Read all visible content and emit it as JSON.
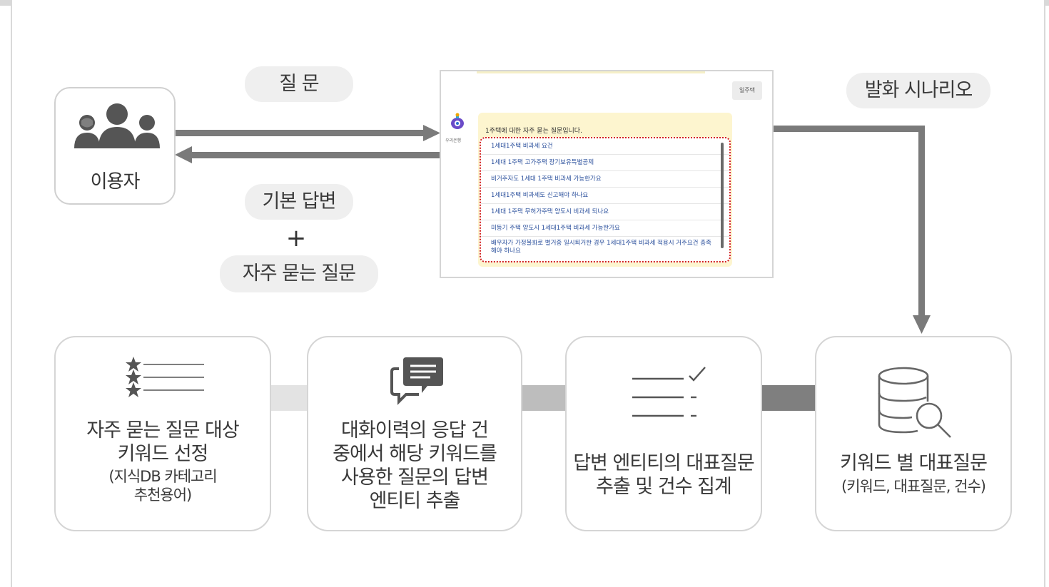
{
  "labels": {
    "question": "질 문",
    "basic_answer": "기본 답변",
    "plus": "+",
    "faq": "자주 묻는 질문",
    "scenario": "발화 시나리오"
  },
  "user": {
    "label": "이용자",
    "icon": "users-icon"
  },
  "chat": {
    "button": "일주택",
    "bot_name": "우리은행",
    "intro": "1주택에 대한 자주 묻는 질문입니다.",
    "items": [
      "1세대1주택 비과세 요건",
      "1세대 1주택 고가주택 장기보유특별공제",
      "비거주자도 1세대 1주택 비과세 가능한가요",
      "1세대1주택 비과세도 신고해야 하나요",
      "1세대 1주택 무허가주택 양도시 비과세 되나요",
      "미등기 주택 양도시 1세대1주택 비과세 가능한가요",
      "배우자가 가정불화로 별거중 일시퇴거한 경우 1세대1주택 비과세 적용시 거주요건 충족해야 하나요"
    ]
  },
  "steps": [
    {
      "icon": "star-list-icon",
      "title": [
        "자주 묻는 질문 대상",
        "키워드 선정"
      ],
      "sub": [
        "(지식DB 카테고리",
        "추천용어)"
      ]
    },
    {
      "icon": "chat-bubbles-icon",
      "title": [
        "대화이력의 응답 건",
        "중에서 해당 키워드를",
        "사용한 질문의 답변",
        "엔티티 추출"
      ],
      "sub": []
    },
    {
      "icon": "checklist-icon",
      "title": [
        "답변 엔티티의 대표질문",
        "추출 및 건수 집계"
      ],
      "sub": []
    },
    {
      "icon": "database-search-icon",
      "title": [
        "키워드 별 대표질문"
      ],
      "sub": [
        "(키워드, 대표질문, 건수)"
      ]
    }
  ],
  "colors": {
    "arrow": "#7a7a7a",
    "pill": "#efefef",
    "faq_border": "#d21f1f",
    "bubble": "#fdf5cf"
  }
}
